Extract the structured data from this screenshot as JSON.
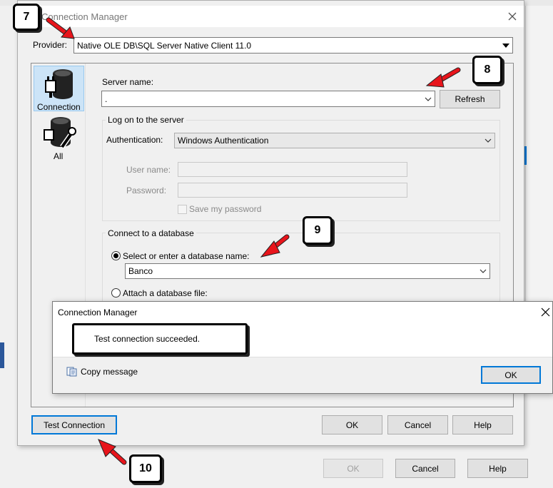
{
  "dialog": {
    "title": "Connection Manager",
    "provider_label": "Provider:",
    "provider_value": "Native OLE DB\\SQL Server Native Client 11.0",
    "sidebar": [
      {
        "label": "Connection",
        "icon": "database-plug-icon"
      },
      {
        "label": "All",
        "icon": "database-wrench-icon"
      }
    ],
    "server_name_label": "Server name:",
    "server_name_value": ".",
    "refresh_label": "Refresh",
    "logon_group_title": "Log on to the server",
    "authentication_label": "Authentication:",
    "authentication_value": "Windows Authentication",
    "user_name_label": "User name:",
    "password_label": "Password:",
    "save_password_label": "Save my password",
    "db_group_title": "Connect to a database",
    "select_db_label": "Select or enter a database name:",
    "db_name_value": "Banco",
    "attach_db_label": "Attach a database file:",
    "test_connection_label": "Test Connection",
    "ok_label": "OK",
    "cancel_label": "Cancel",
    "help_label": "Help"
  },
  "message_box": {
    "title": "Connection Manager",
    "message": "Test connection succeeded.",
    "copy_message_label": "Copy message",
    "ok_label": "OK"
  },
  "parent_buttons": {
    "ok_label": "OK",
    "cancel_label": "Cancel",
    "help_label": "Help"
  },
  "callouts": [
    "7",
    "8",
    "9",
    "10"
  ],
  "colors": {
    "accent": "#0078d7",
    "arrow": "#e8141b"
  }
}
